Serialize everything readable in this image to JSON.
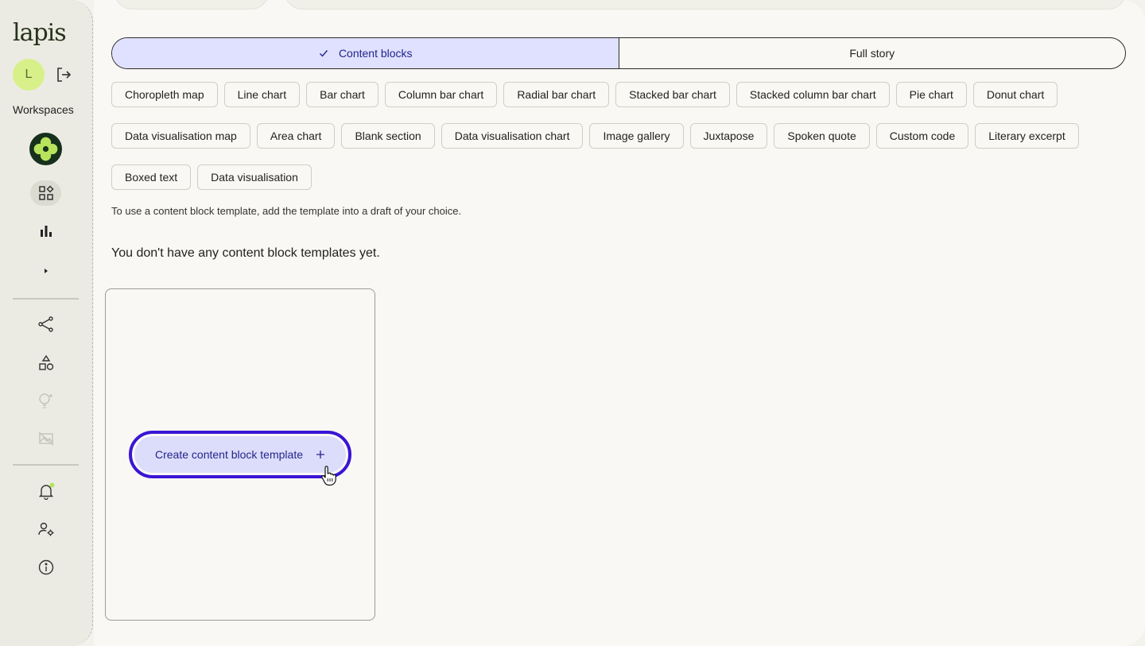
{
  "sidebar": {
    "logo": "lapis",
    "avatar_initial": "L",
    "workspaces_label": "Workspaces",
    "icons": [
      "logout-icon",
      "workspace-logo-icon",
      "templates-grid-icon",
      "bar-chart-icon",
      "expand-arrow-icon",
      "share-icon",
      "shapes-icon",
      "ideas-bulb-icon",
      "image-disabled-icon",
      "notifications-bell-icon",
      "user-settings-icon",
      "info-icon"
    ],
    "accent_color": "#d7f08a"
  },
  "toggle": {
    "content_blocks": "Content blocks",
    "full_story": "Full story"
  },
  "chip_rows": [
    [
      "Choropleth map",
      "Line chart",
      "Bar chart",
      "Column bar chart",
      "Radial bar chart",
      "Stacked bar chart",
      "Stacked column bar chart",
      "Pie chart",
      "Donut chart"
    ],
    [
      "Data visualisation map",
      "Area chart",
      "Blank section",
      "Data visualisation chart",
      "Image gallery",
      "Juxtapose",
      "Spoken quote",
      "Custom code",
      "Literary excerpt"
    ],
    [
      "Boxed text",
      "Data visualisation"
    ]
  ],
  "hint": "To use a content block template, add the template into a draft of your choice.",
  "empty_message": "You don't have any content block templates yet.",
  "create_button": {
    "label": "Create content block template",
    "icon": "plus-icon"
  },
  "colors": {
    "highlight": "#3a14d6",
    "selected_bg": "#dfe1ff"
  }
}
